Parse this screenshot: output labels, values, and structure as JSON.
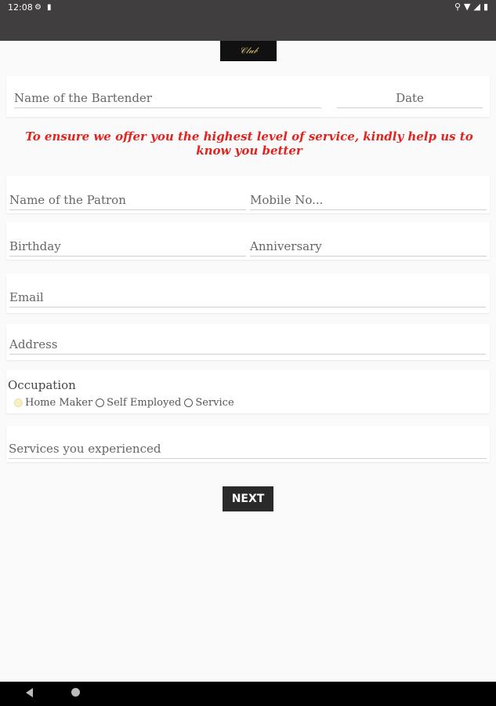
{
  "status_bar": {
    "time": "12:08",
    "icons": [
      "gear-icon",
      "sd-card-icon",
      "location-icon",
      "wifi-icon",
      "signal-icon",
      "battery-icon"
    ]
  },
  "logo": {
    "alt": "Bar logo"
  },
  "bartender_card": {
    "name_placeholder": "Name of the Bartender",
    "date_placeholder": "Date"
  },
  "notice": "To ensure we offer you the highest level of service, kindly help us to know you better",
  "patron_card": {
    "name_placeholder": "Name of the Patron",
    "mobile_placeholder": "Mobile No..."
  },
  "dates_card": {
    "birthday_placeholder": "Birthday",
    "anniversary_placeholder": "Anniversary"
  },
  "email_placeholder": "Email",
  "address_placeholder": "Address",
  "occupation": {
    "label": "Occupation",
    "options": [
      "Home Maker",
      "Self Employed",
      "Service"
    ],
    "selected": "Home Maker"
  },
  "services_placeholder": "Services you experienced",
  "next_label": "NEXT",
  "colors": {
    "status_bar": "#413e3f",
    "notice": "#e5221e",
    "button": "#2b2a2b"
  }
}
